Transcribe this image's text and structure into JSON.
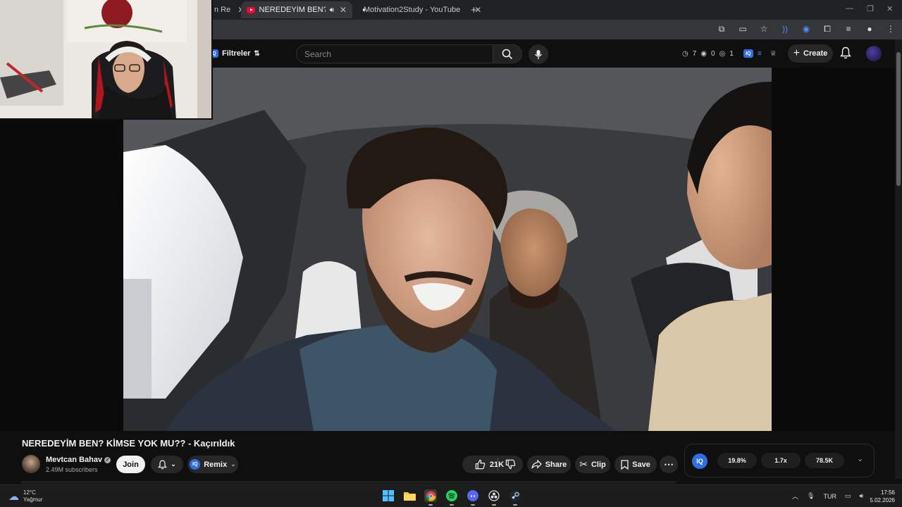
{
  "browser": {
    "tabs": [
      {
        "label": "n Re",
        "active": false
      },
      {
        "label": "NEREDEYİM BEN? KİMSE YO",
        "active": true
      },
      {
        "label": "Motivation2Study - YouTube",
        "active": false
      }
    ],
    "new_tab": "+"
  },
  "header": {
    "filter_label": "Filtreler",
    "search_placeholder": "Search",
    "stats": {
      "views": "7",
      "watched": "0",
      "other": "1"
    },
    "create_label": "Create"
  },
  "video": {
    "title": "NEREDEYİM BEN? KİMSE YOK MU?? - Kaçırıldık"
  },
  "channel": {
    "name": "Mevtcan Bahav",
    "subscribers": "2.49M subscribers",
    "join_label": "Join",
    "remix_label": "Remix"
  },
  "actions": {
    "likes": "21K",
    "share_label": "Share",
    "clip_label": "Clip",
    "save_label": "Save"
  },
  "iq_panel": {
    "logo": "IQ",
    "metric1": "19.8%",
    "metric2": "1.7x",
    "metric3": "78.5K"
  },
  "taskbar": {
    "temperature": "12°C",
    "condition": "Yağmur",
    "language": "TUR",
    "time": "17:56",
    "date": "5.02.2026"
  }
}
